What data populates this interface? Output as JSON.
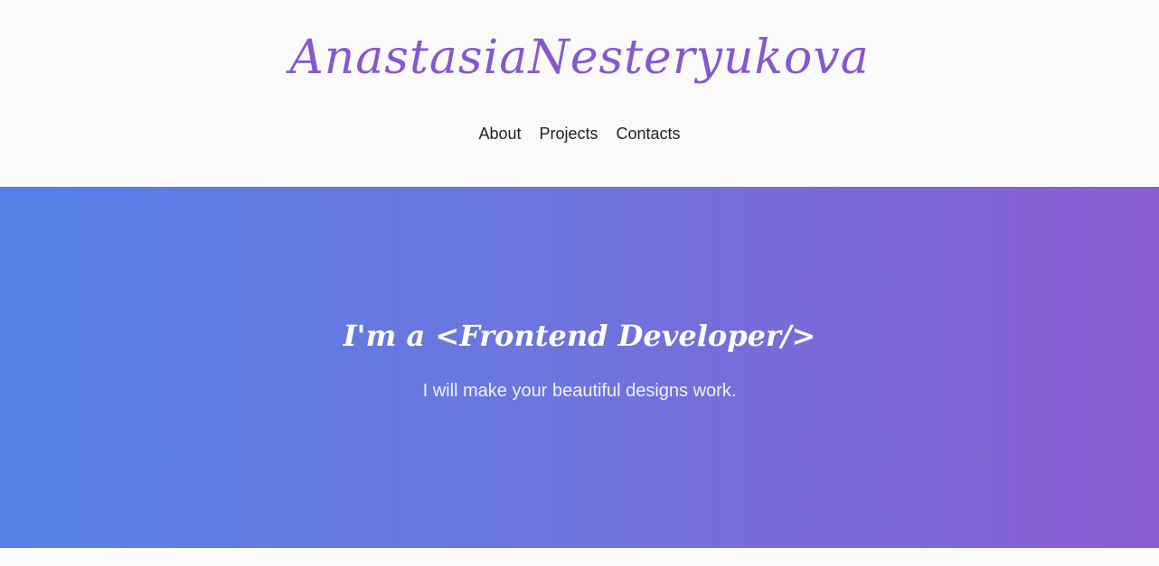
{
  "header": {
    "logo_text": "AnastasiaNesteryukova",
    "nav": [
      {
        "label": "About"
      },
      {
        "label": "Projects"
      },
      {
        "label": "Contacts"
      }
    ]
  },
  "hero": {
    "title": "I'm a <Frontend Developer/>",
    "subtitle": "I will make your beautiful designs work."
  },
  "colors": {
    "accent": "#8558cf",
    "gradient_start": "#5581e8",
    "gradient_end": "#8a5dd2",
    "page_background": "#fafafa"
  }
}
